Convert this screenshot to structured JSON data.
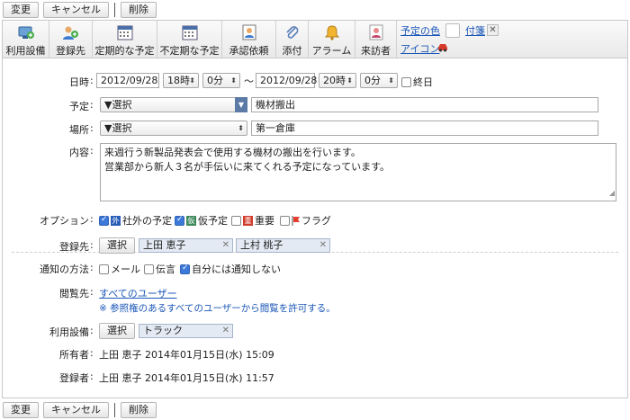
{
  "actions": {
    "change": "変更",
    "cancel": "キャンセル",
    "delete": "削除"
  },
  "toolbar": {
    "items": [
      {
        "label": "利用設備"
      },
      {
        "label": "登録先"
      },
      {
        "label": "定期的な予定"
      },
      {
        "label": "不定期な予定"
      },
      {
        "label": "承認依頼"
      },
      {
        "label": "添付"
      },
      {
        "label": "アラーム"
      },
      {
        "label": "来訪者"
      }
    ],
    "color_link": "予定の色",
    "sticky_link": "付箋",
    "icon_link": "アイコン",
    "close_glyph": "✕"
  },
  "form": {
    "datetime": {
      "label": "日時",
      "start_date": "2012/09/28",
      "start_hour": "18時",
      "start_min": "0分",
      "tilde": "〜",
      "end_date": "2012/09/28",
      "end_hour": "20時",
      "end_min": "0分",
      "allday": "終日"
    },
    "plan": {
      "label": "予定",
      "select": "▼選択",
      "value": "機材搬出"
    },
    "place": {
      "label": "場所",
      "select": "▼選択",
      "value": "第一倉庫"
    },
    "content": {
      "label": "内容",
      "line1": "来週行う新製品発表会で使用する機材の搬出を行います。",
      "line2": "営業部から新人３名が手伝いに来てくれる予定になっています。"
    },
    "options": {
      "label": "オプション",
      "items": [
        {
          "text": "社外の予定",
          "badge": "外",
          "badge_color": "#2a5fb8",
          "checked": true
        },
        {
          "text": "仮予定",
          "badge": "仮",
          "badge_color": "#3f8a5c",
          "checked": true
        },
        {
          "text": "重要",
          "badge": "重",
          "badge_color": "#d23a2a",
          "checked": false
        },
        {
          "text": "フラグ",
          "badge": "",
          "badge_color": "#e53e2e",
          "checked": false
        }
      ]
    },
    "registrants": {
      "label": "登録先",
      "select_btn": "選択",
      "users": [
        "上田 恵子",
        "上村 桃子"
      ]
    },
    "notify": {
      "label": "通知の方法",
      "items": [
        {
          "text": "メール",
          "checked": false
        },
        {
          "text": "伝言",
          "checked": false
        },
        {
          "text": "自分には通知しない",
          "checked": true
        }
      ]
    },
    "viewers": {
      "label": "閲覧先",
      "link": "すべてのユーザー",
      "note": "※ 参照権のあるすべてのユーザーから閲覧を許可する。"
    },
    "equipment": {
      "label": "利用設備",
      "select_btn": "選択",
      "item": "トラック"
    },
    "owner": {
      "label": "所有者",
      "name": "上田 恵子",
      "date": "2014年01月15日(水) 15:09"
    },
    "registrar": {
      "label": "登録者",
      "name": "上田 恵子",
      "date": "2014年01月15日(水) 11:57"
    }
  }
}
